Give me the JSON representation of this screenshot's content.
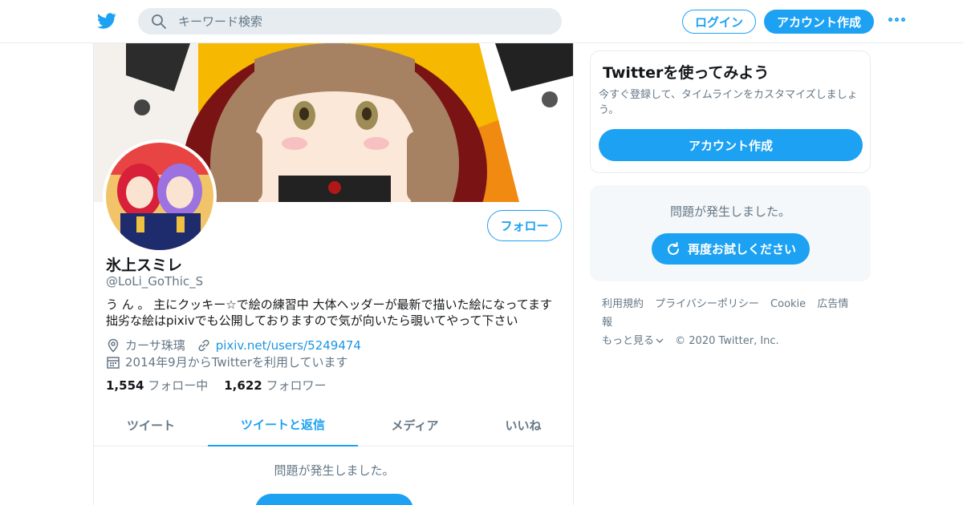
{
  "header": {
    "search_placeholder": "キーワード検索",
    "login_label": "ログイン",
    "signup_label": "アカウント作成"
  },
  "profile": {
    "follow_label": "フォロー",
    "name": "氷上スミレ",
    "handle": "@LoLi_GoThic_S",
    "bio_line1": "う ん 。 主にクッキー☆で絵の練習中 大体ヘッダーが最新で描いた絵になってます",
    "bio_line2": "拙劣な絵はpixivでも公開しておりますので気が向いたら覗いてやって下さい",
    "location": "カーサ珠璃",
    "url": "pixiv.net/users/5249474",
    "joined": "2014年9月からTwitterを利用しています",
    "following_count": "1,554",
    "following_label": "フォロー中",
    "followers_count": "1,622",
    "followers_label": "フォロワー"
  },
  "tabs": [
    "ツイート",
    "ツイートと返信",
    "メディア",
    "いいね"
  ],
  "active_tab": 1,
  "timeline": {
    "error_message": "問題が発生しました。"
  },
  "sidebar": {
    "promo_title": "Twitterを使ってみよう",
    "promo_text": "今すぐ登録して、タイムラインをカスタマイズしましょう。",
    "promo_button": "アカウント作成",
    "error_message": "問題が発生しました。",
    "retry_label": "再度お試しください"
  },
  "footer": {
    "links": [
      "利用規約",
      "プライバシーポリシー",
      "Cookie",
      "広告情報",
      "もっと見る"
    ],
    "copyright": "© 2020 Twitter, Inc."
  },
  "colors": {
    "accent": "#1da1f2",
    "text_secondary": "#657786",
    "border": "#e6ecf0"
  }
}
